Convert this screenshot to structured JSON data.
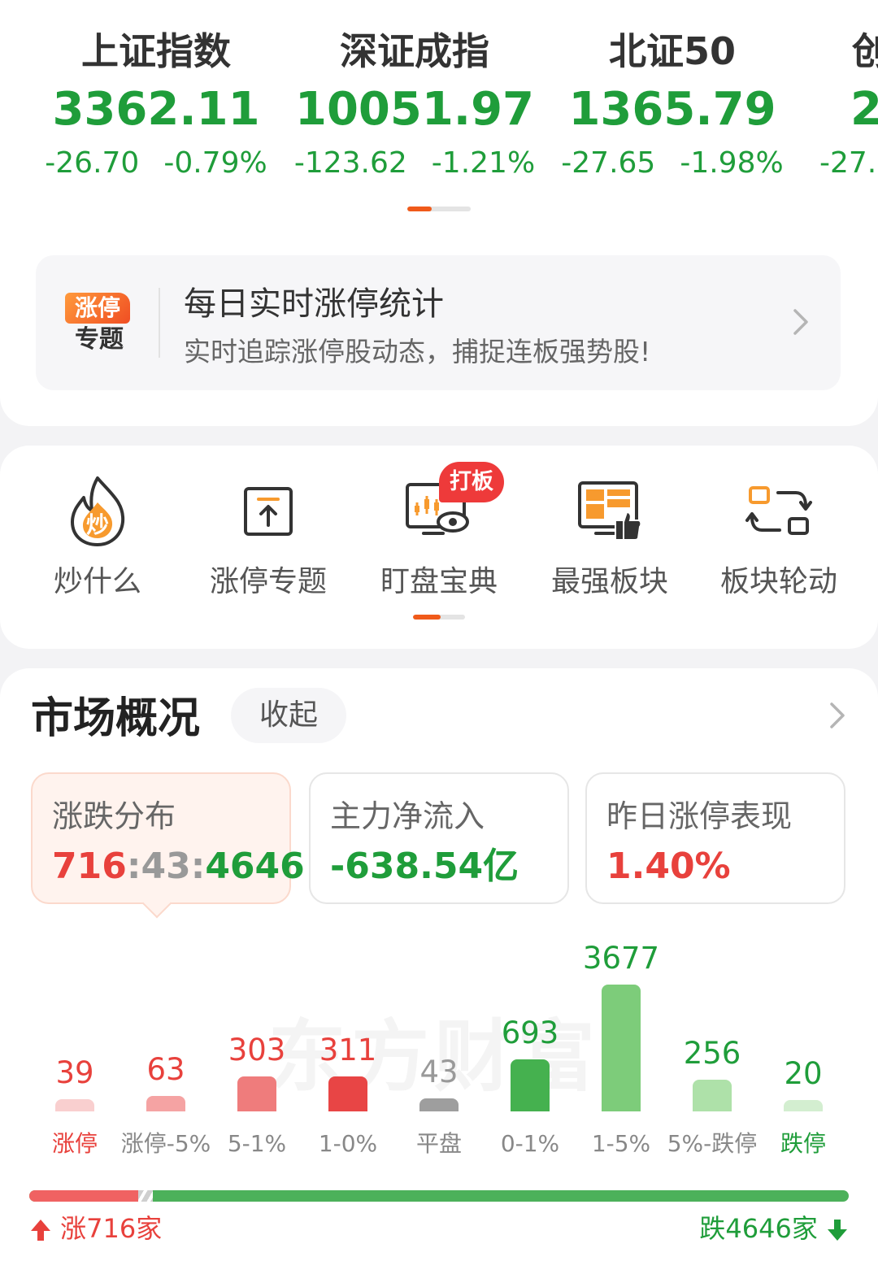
{
  "indices": [
    {
      "name": "上证指数",
      "value": "3362.11",
      "change": "-26.70",
      "percent": "-0.79%"
    },
    {
      "name": "深证成指",
      "value": "10051.97",
      "change": "-123.62",
      "percent": "-1.21%"
    },
    {
      "name": "北证50",
      "value": "1365.79",
      "change": "-27.65",
      "percent": "-1.98%"
    },
    {
      "name": "创",
      "value": "2",
      "change": "-27.",
      "percent": ""
    }
  ],
  "banner": {
    "logo_top": "涨停",
    "logo_bottom": "专题",
    "title": "每日实时涨停统计",
    "subtitle": "实时追踪涨停股动态，捕捉连板强势股!"
  },
  "tools": [
    {
      "label": "炒什么",
      "icon": "flame-icon",
      "icon_text": "炒"
    },
    {
      "label": "涨停专题",
      "icon": "upload-box-icon"
    },
    {
      "label": "盯盘宝典",
      "icon": "monitor-eye-icon",
      "badge": "打板"
    },
    {
      "label": "最强板块",
      "icon": "board-thumb-icon"
    },
    {
      "label": "板块轮动",
      "icon": "rotate-icon"
    }
  ],
  "market": {
    "title": "市场概况",
    "collapse_label": "收起",
    "stats": [
      {
        "label": "涨跌分布",
        "value_up": "716",
        "sep1": ":",
        "value_flat": "43",
        "sep2": ":",
        "value_down": "4646"
      },
      {
        "label": "主力净流入",
        "value": "-638.54亿"
      },
      {
        "label": "昨日涨停表现",
        "value": "1.40%"
      }
    ],
    "watermark": "东方财富",
    "distribution": [
      {
        "label": "涨停",
        "count": "39",
        "value": 39,
        "color": "#f9cfcf",
        "text_color": "#e8413c",
        "label_color": "#e8413c"
      },
      {
        "label": "涨停-5%",
        "count": "63",
        "value": 63,
        "color": "#f5a3a3",
        "text_color": "#e8413c",
        "label_color": "#888888"
      },
      {
        "label": "5-1%",
        "count": "303",
        "value": 303,
        "color": "#ef7c7c",
        "text_color": "#e8413c",
        "label_color": "#888888"
      },
      {
        "label": "1-0%",
        "count": "311",
        "value": 311,
        "color": "#e84545",
        "text_color": "#e8413c",
        "label_color": "#888888"
      },
      {
        "label": "平盘",
        "count": "43",
        "value": 43,
        "color": "#9e9e9e",
        "text_color": "#999999",
        "label_color": "#888888"
      },
      {
        "label": "0-1%",
        "count": "693",
        "value": 693,
        "color": "#45b14f",
        "text_color": "#1f9d3a",
        "label_color": "#888888"
      },
      {
        "label": "1-5%",
        "count": "3677",
        "value": 3677,
        "color": "#7dcc7a",
        "text_color": "#1f9d3a",
        "label_color": "#888888"
      },
      {
        "label": "5%-跌停",
        "count": "256",
        "value": 256,
        "color": "#aee1a9",
        "text_color": "#1f9d3a",
        "label_color": "#888888"
      },
      {
        "label": "跌停",
        "count": "20",
        "value": 20,
        "color": "#d3eed0",
        "text_color": "#1f9d3a",
        "label_color": "#1f9d3a"
      }
    ],
    "rise_text": "涨716家",
    "fall_text": "跌4646家",
    "rise_count": 716,
    "flat_count": 43,
    "fall_count": 4646
  },
  "colors": {
    "up": "#e8413c",
    "down": "#1f9d3a",
    "accent": "#f05a1a"
  }
}
